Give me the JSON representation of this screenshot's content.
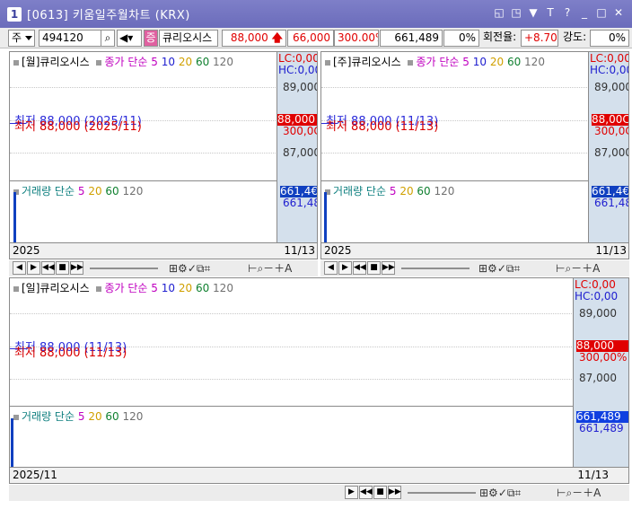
{
  "title": {
    "number": "1",
    "text": "[0613] 키움일주월차트 (KRX)",
    "icons": [
      "restore-window-icon",
      "copy-window-icon",
      "pin-icon",
      "font-icon",
      "help-icon",
      "minimize-icon",
      "maximize-icon",
      "close-icon"
    ],
    "icon_glyphs": [
      "◱",
      "◳",
      "▼",
      "T",
      "?",
      "_",
      "□",
      "✕"
    ]
  },
  "toolbar": {
    "type": "주",
    "code": "494120",
    "name": "큐리오시스",
    "price": "88,000",
    "change": "66,000",
    "change_rate": "300.00%",
    "volume": "661,489",
    "vol_rate": "0%",
    "turnover_label": "회전율:",
    "turnover": "+8.70%",
    "strength_label": "강도:",
    "strength": "0%"
  },
  "monthly": {
    "title": "[월]큐리오시스",
    "ma_label": "종가 단순",
    "ma": [
      "5",
      "10",
      "20",
      "60",
      "120"
    ],
    "lc": "LC:0,00",
    "hc": "HC:0,00",
    "y_high": "89,000",
    "y_low": "87,000",
    "price_tag": "88,000",
    "rate_tag": "300,0C",
    "mark": "최저 88,000 (2025/11)",
    "mark2": "최저 88,000 (2025/11)",
    "vol_label": "거래량 단순",
    "vol_ma": [
      "5",
      "20",
      "60",
      "120"
    ],
    "vol_tag": "661,4€",
    "vol_tag2": "661,48C",
    "date_left": "2025",
    "date_right": "11/13"
  },
  "weekly": {
    "title": "[주]큐리오시스",
    "ma_label": "종가 단순",
    "ma": [
      "5",
      "10",
      "20",
      "60",
      "120"
    ],
    "lc": "LC:0,00",
    "hc": "HC:0,00",
    "y_high": "89,000",
    "y_low": "87,000",
    "price_tag": "88,00C",
    "rate_tag": "300,0C",
    "mark": "최저 88,000 (11/13)",
    "mark2": "최저 88,000 (11/13)",
    "vol_label": "거래량 단순",
    "vol_ma": [
      "5",
      "20",
      "60",
      "120"
    ],
    "vol_tag": "661,4€",
    "vol_tag2": "661,48C",
    "date_left": "2025",
    "date_right": "11/13"
  },
  "daily": {
    "title": "[일]큐리오시스",
    "ma_label": "종가 단순",
    "ma": [
      "5",
      "10",
      "20",
      "60",
      "120"
    ],
    "lc": "LC:0,00",
    "hc": "HC:0,00",
    "y_high": "89,000",
    "y_low": "87,000",
    "price_tag": "88,000",
    "rate_tag": "300,00%",
    "mark": "최저 88,000 (11/13)",
    "mark2": "최저 88,000 (11/13)",
    "vol_label": "거래량 단순",
    "vol_ma": [
      "5",
      "20",
      "60",
      "120"
    ],
    "vol_tag": "661,489",
    "vol_tag2": "661,489",
    "date_left": "2025/11",
    "date_right": "11/13"
  },
  "colors": {
    "ma5": "#c000c0",
    "ma10": "#2020d0",
    "ma20": "#d0a000",
    "ma60": "#108030",
    "ma120": "#707070",
    "red": "#e00000",
    "blue": "#2b2bd9",
    "axis_bg": "#d4e0ec"
  }
}
